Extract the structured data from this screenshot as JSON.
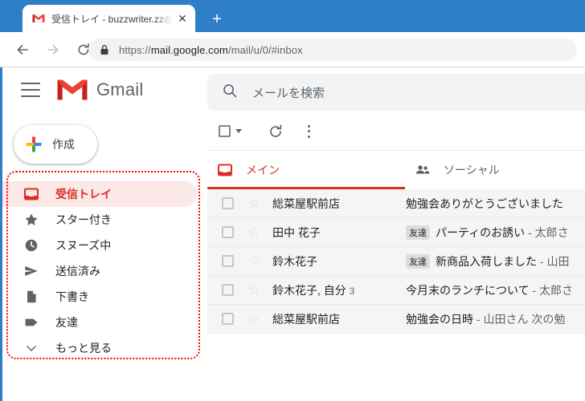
{
  "browser": {
    "tab": {
      "title": "受信トレイ - buzzwriter.zz@gmail.c",
      "favicon": "gmail-favicon",
      "close_label": "✕"
    },
    "new_tab_label": "+",
    "back_label": "←",
    "forward_label": "→",
    "reload_label": "⟳",
    "url_host": "mail.google.com",
    "url_prefix": "https://",
    "url_path": "/mail/u/0/#inbox"
  },
  "gmail": {
    "menu_icon": "hamburger-icon",
    "brand": "Gmail",
    "search": {
      "placeholder": "メールを検索",
      "icon": "search-icon"
    },
    "compose": {
      "label": "作成",
      "icon": "google-plus-icon"
    },
    "nav": [
      {
        "label": "受信トレイ",
        "icon": "inbox-icon",
        "active": true
      },
      {
        "label": "スター付き",
        "icon": "star-icon",
        "active": false
      },
      {
        "label": "スヌーズ中",
        "icon": "clock-icon",
        "active": false
      },
      {
        "label": "送信済み",
        "icon": "send-icon",
        "active": false
      },
      {
        "label": "下書き",
        "icon": "draft-icon",
        "active": false
      },
      {
        "label": "友達",
        "icon": "label-icon",
        "active": false
      },
      {
        "label": "もっと見る",
        "icon": "chevron-down-icon",
        "active": false
      }
    ],
    "list_toolbar": {
      "select_all_icon": "checkbox-icon",
      "select_all_caret": "chevron-down-icon",
      "refresh_icon": "refresh-icon",
      "more_icon": "more-vertical-icon"
    },
    "tabs": [
      {
        "label": "メイン",
        "icon": "inbox-icon",
        "active": true
      },
      {
        "label": "ソーシャル",
        "icon": "people-icon",
        "active": false
      }
    ],
    "rows": [
      {
        "sender": "総菜屋駅前店",
        "count": "",
        "chip": "",
        "subject": "勉強会ありがとうございました",
        "snippet": ""
      },
      {
        "sender": "田中 花子",
        "count": "",
        "chip": "友達",
        "subject": "パーティのお誘い",
        "snippet": "- 太郎さ"
      },
      {
        "sender": "鈴木花子",
        "count": "",
        "chip": "友達",
        "subject": "新商品入荷しました",
        "snippet": "- 山田"
      },
      {
        "sender": "鈴木花子, 自分",
        "count": "3",
        "chip": "",
        "subject": "今月末のランチについて",
        "snippet": "- 太郎さ"
      },
      {
        "sender": "総菜屋駅前店",
        "count": "",
        "chip": "",
        "subject": "勉強会の日時",
        "snippet": "- 山田さん 次の勉"
      }
    ]
  },
  "annotation": {
    "name": "sidebar-highlight-box",
    "color": "#ff0000"
  },
  "colors": {
    "chrome_blue": "#2f7fc6",
    "gmail_red": "#d93025",
    "active_bg": "#fce8e6",
    "row_bg": "#f5f5f5",
    "search_bg": "#f1f3f4"
  }
}
